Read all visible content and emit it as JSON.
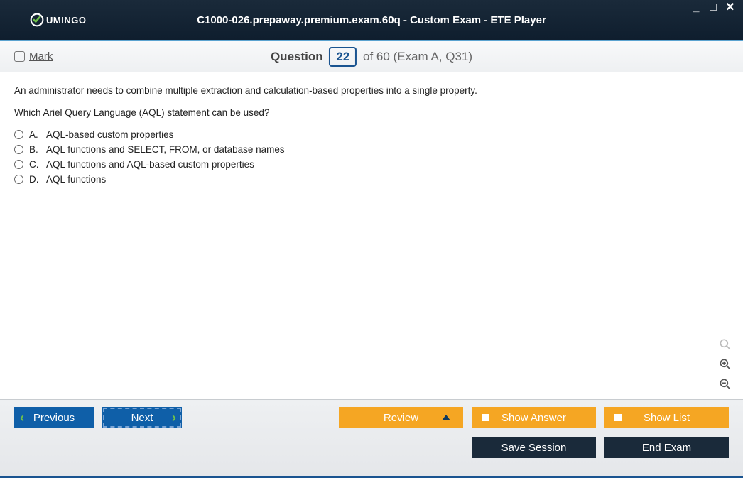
{
  "window": {
    "title": "C1000-026.prepaway.premium.exam.60q - Custom Exam - ETE Player",
    "brand": "UMINGO"
  },
  "questionBar": {
    "mark_label": "Mark",
    "question_label": "Question",
    "current": "22",
    "total_text": "of 60 (Exam A, Q31)"
  },
  "question": {
    "line1": "An administrator needs to combine multiple extraction and calculation-based properties into a single property.",
    "line2": "Which Ariel Query Language (AQL) statement can be used?",
    "answers": [
      {
        "letter": "A.",
        "text": "AQL-based custom properties"
      },
      {
        "letter": "B.",
        "text": "AQL functions and SELECT, FROM, or database names"
      },
      {
        "letter": "C.",
        "text": "AQL functions and AQL-based custom properties"
      },
      {
        "letter": "D.",
        "text": "AQL functions"
      }
    ]
  },
  "footer": {
    "previous": "Previous",
    "next": "Next",
    "review": "Review",
    "show_answer": "Show Answer",
    "show_list": "Show List",
    "save_session": "Save Session",
    "end_exam": "End Exam"
  }
}
